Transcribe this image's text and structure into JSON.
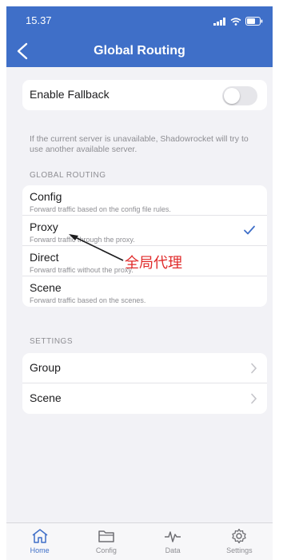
{
  "status_bar": {
    "time": "15.37"
  },
  "nav": {
    "title": "Global Routing"
  },
  "fallback": {
    "label": "Enable Fallback",
    "enabled": false,
    "note": "If the current server is unavailable, Shadowrocket will try to use another available server."
  },
  "routing": {
    "header": "GLOBAL ROUTING",
    "items": [
      {
        "label": "Config",
        "sub": "Forward traffic based on the config file rules.",
        "selected": false
      },
      {
        "label": "Proxy",
        "sub": "Forward traffic through the proxy.",
        "selected": true
      },
      {
        "label": "Direct",
        "sub": "Forward traffic without the proxy.",
        "selected": false
      },
      {
        "label": "Scene",
        "sub": "Forward traffic based on the scenes.",
        "selected": false
      }
    ]
  },
  "annotation": {
    "text": "全局代理",
    "color": "#e02b2b"
  },
  "settings": {
    "header": "SETTINGS",
    "items": [
      {
        "label": "Group"
      },
      {
        "label": "Scene"
      }
    ]
  },
  "tabbar": {
    "tabs": [
      {
        "label": "Home",
        "icon": "home-icon",
        "active": true
      },
      {
        "label": "Config",
        "icon": "folder-icon",
        "active": false
      },
      {
        "label": "Data",
        "icon": "pulse-icon",
        "active": false
      },
      {
        "label": "Settings",
        "icon": "gear-icon",
        "active": false
      }
    ]
  },
  "colors": {
    "accent": "#3f6fc8",
    "background": "#f2f2f6"
  }
}
